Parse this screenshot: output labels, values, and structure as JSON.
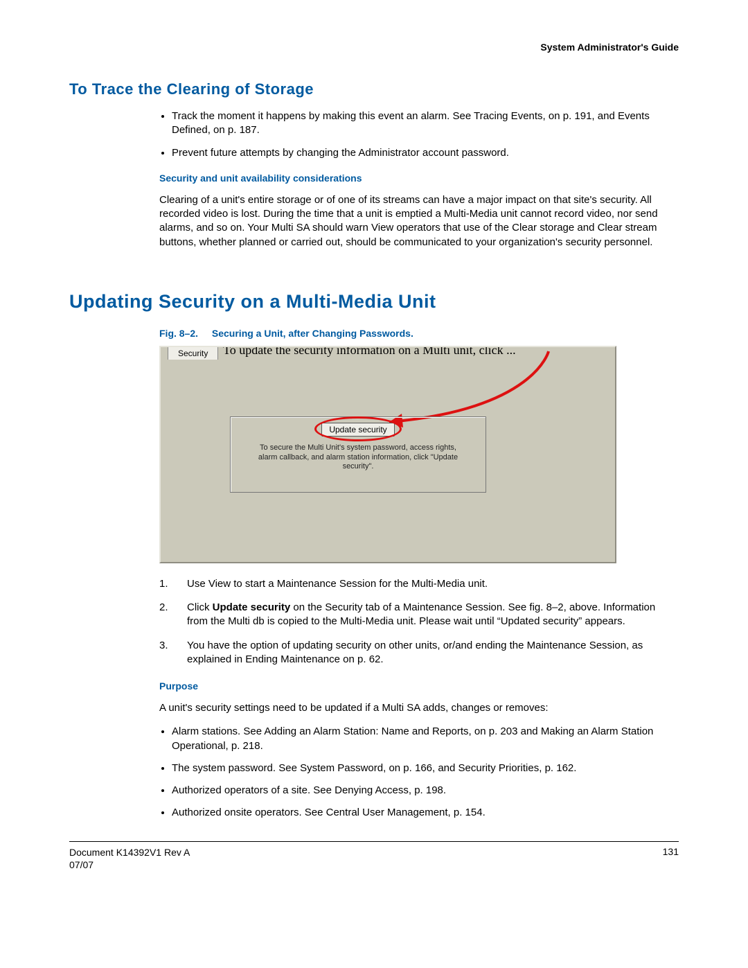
{
  "runningHead": "System Administrator's Guide",
  "h2_trace": "To Trace the Clearing of Storage",
  "trace_bullets": [
    "Track the moment it happens by making this event an alarm. See Tracing Events, on p. 191, and Events Defined, on p. 187.",
    "Prevent future attempts by changing the Administrator account password."
  ],
  "sec_runin": "Security and unit availability considerations",
  "sec_para": "Clearing of a unit's entire storage or of one of its streams can have a major impact on that site's security. All recorded video is lost. During the time that a unit is emptied a Multi-Media unit cannot record video, nor send alarms, and so on. Your Multi SA should warn View operators that use of the Clear storage and Clear stream buttons, whether planned or carried out, should be communicated to your organization's security personnel.",
  "h1_update": "Updating Security on a Multi-Media Unit",
  "fig": {
    "num": "Fig. 8–2.",
    "title": "Securing a Unit, after Changing Passwords.",
    "tab": "Security",
    "topnote": "To update the security information on a Multi unit, click ...",
    "button": "Update security",
    "desc": "To secure the Multi Unit's system password, access rights, alarm callback, and alarm station information, click \"Update security\"."
  },
  "steps": [
    {
      "n": "1.",
      "t_before": "Use View to start a Maintenance Session for the Multi-Media unit.",
      "bold": "",
      "t_after": ""
    },
    {
      "n": "2.",
      "t_before": "Click ",
      "bold": "Update security",
      "t_after": " on the Security tab of a Maintenance Session. See fig. 8–2, above. Information from the Multi db is copied to the Multi-Media unit. Please wait until “Updated security” appears."
    },
    {
      "n": "3.",
      "t_before": "You have the option of updating security on other units, or/and ending the Maintenance Session, as explained in Ending Maintenance on p. 62.",
      "bold": "",
      "t_after": ""
    }
  ],
  "purpose_runin": "Purpose",
  "purpose_intro": "A unit's security settings need to be updated if a Multi SA adds, changes or removes:",
  "purpose_bullets": [
    "Alarm stations. See Adding an Alarm Station: Name and Reports, on p. 203 and Making an Alarm Station Operational, p. 218.",
    "The system password. See System Password, on p. 166, and Security Priorities, p. 162.",
    "Authorized operators of a site. See Denying Access, p. 198.",
    "Authorized onsite operators. See Central User Management, p. 154."
  ],
  "footer": {
    "doc": "Document K14392V1 Rev A",
    "date": "07/07",
    "page": "131"
  }
}
